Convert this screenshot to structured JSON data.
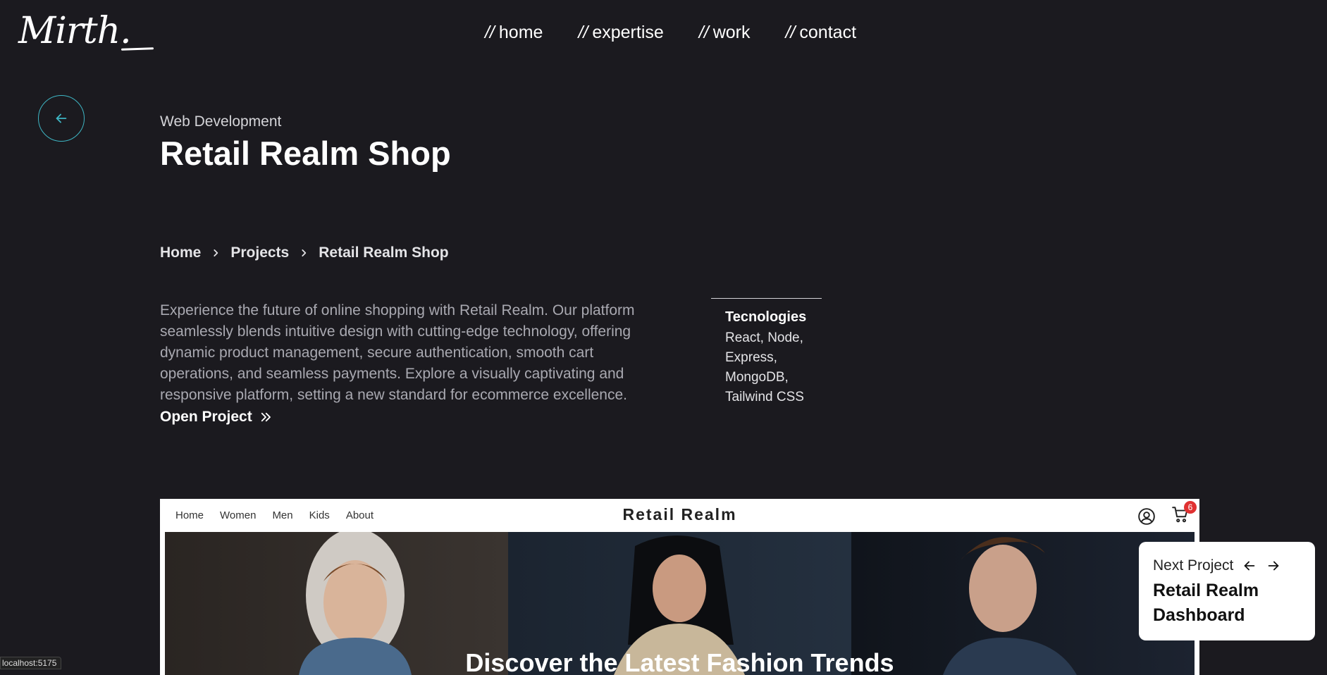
{
  "brand": {
    "logo": "Mirth."
  },
  "nav": [
    {
      "prefix": "//",
      "label": "home"
    },
    {
      "prefix": "//",
      "label": "expertise"
    },
    {
      "prefix": "//",
      "label": "work"
    },
    {
      "prefix": "//",
      "label": "contact"
    }
  ],
  "project": {
    "category": "Web Development",
    "title": "Retail Realm Shop",
    "description": "Experience the future of online shopping with Retail Realm. Our platform seamlessly blends intuitive design with cutting-edge technology, offering dynamic product management, secure authentication, smooth cart operations, and seamless payments. Explore a visually captivating and responsive platform, setting a new standard for ecommerce excellence.",
    "open_label": "Open Project"
  },
  "breadcrumb": [
    "Home",
    "Projects",
    "Retail Realm Shop"
  ],
  "technologies": {
    "title": "Tecnologies",
    "list": "React, Node, Express, MongoDB, Tailwind CSS"
  },
  "preview": {
    "links": [
      "Home",
      "Women",
      "Men",
      "Kids",
      "About"
    ],
    "brand": "Retail Realm",
    "cart_count": "6",
    "hero_text": "Discover the Latest Fashion Trends"
  },
  "next_project": {
    "label": "Next Project",
    "title": "Retail Realm Dashboard"
  },
  "status_bar": "localhost:5175",
  "colors": {
    "background": "#1b1a1f",
    "accent": "#3eb6c4",
    "badge": "#e03131"
  }
}
